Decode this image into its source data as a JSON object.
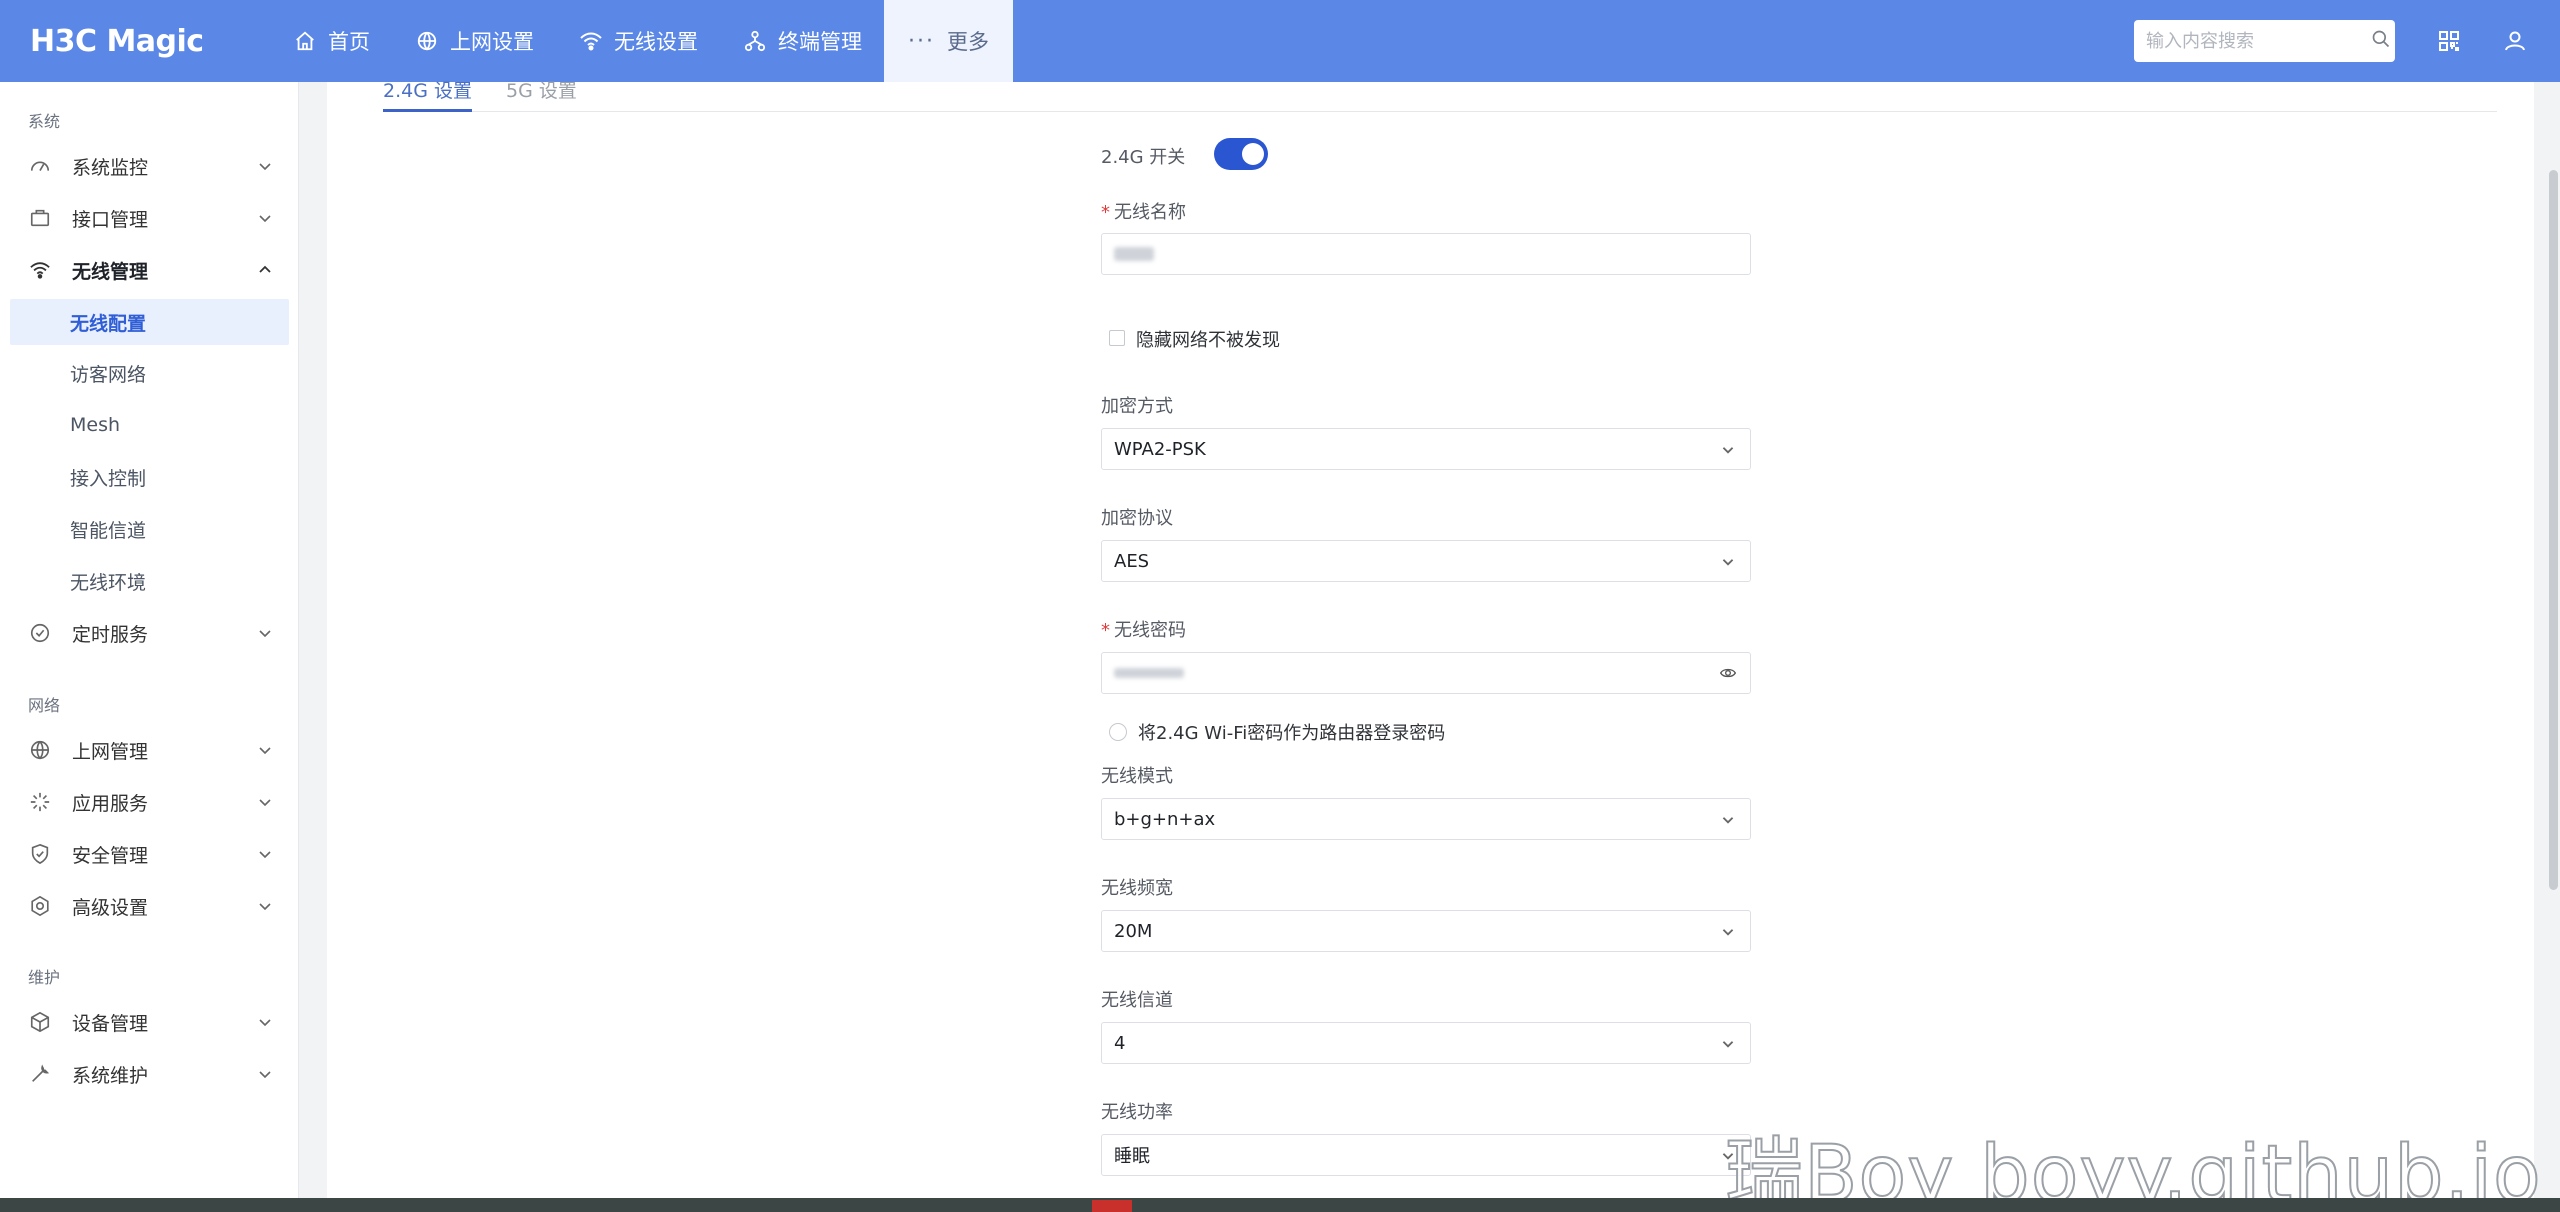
{
  "header": {
    "logo": "H3C Magic",
    "nav": [
      {
        "label": "首页",
        "icon": "home-icon"
      },
      {
        "label": "上网设置",
        "icon": "globe-icon"
      },
      {
        "label": "无线设置",
        "icon": "wifi-icon"
      },
      {
        "label": "终端管理",
        "icon": "network-icon"
      },
      {
        "label": "更多",
        "icon": "more-dots-icon"
      }
    ],
    "search_placeholder": "输入内容搜索"
  },
  "sidebar": {
    "sections": [
      "系统",
      "网络",
      "维护"
    ],
    "items": [
      {
        "label": "系统监控",
        "icon": "gauge-icon"
      },
      {
        "label": "接口管理",
        "icon": "interface-icon"
      },
      {
        "label": "无线管理",
        "icon": "wifi-icon",
        "expanded": true
      },
      {
        "label": "定时服务",
        "icon": "clock-icon"
      },
      {
        "label": "上网管理",
        "icon": "globe-icon"
      },
      {
        "label": "应用服务",
        "icon": "app-service-icon"
      },
      {
        "label": "安全管理",
        "icon": "shield-icon"
      },
      {
        "label": "高级设置",
        "icon": "settings-icon"
      },
      {
        "label": "设备管理",
        "icon": "device-box-icon"
      },
      {
        "label": "系统维护",
        "icon": "wrench-icon"
      }
    ],
    "subitems": [
      "无线配置",
      "访客网络",
      "Mesh",
      "接入控制",
      "智能信道",
      "无线环境"
    ],
    "selected_subitem": "无线配置"
  },
  "tabs": [
    {
      "label": "2.4G 设置",
      "active": true
    },
    {
      "label": "5G 设置",
      "active": false
    }
  ],
  "form": {
    "switch_label": "2.4G 开关",
    "switch_on": true,
    "ssid_label": "无线名称",
    "hide_ssid_label": "隐藏网络不被发现",
    "encryption_label": "加密方式",
    "encryption_value": "WPA2-PSK",
    "protocol_label": "加密协议",
    "protocol_value": "AES",
    "password_label": "无线密码",
    "use_as_login_label": "将2.4G Wi-Fi密码作为路由器登录密码",
    "mode_label": "无线模式",
    "mode_value": "b+g+n+ax",
    "bandwidth_label": "无线频宽",
    "bandwidth_value": "20M",
    "channel_label": "无线信道",
    "channel_value": "4",
    "power_label": "无线功率",
    "power_value": "睡眠"
  },
  "watermark": "瑞Boy  boyy.github.io",
  "colors": {
    "header_bg": "#5b88e6",
    "accent": "#2b56d1",
    "selected_bg": "#e8effd"
  }
}
